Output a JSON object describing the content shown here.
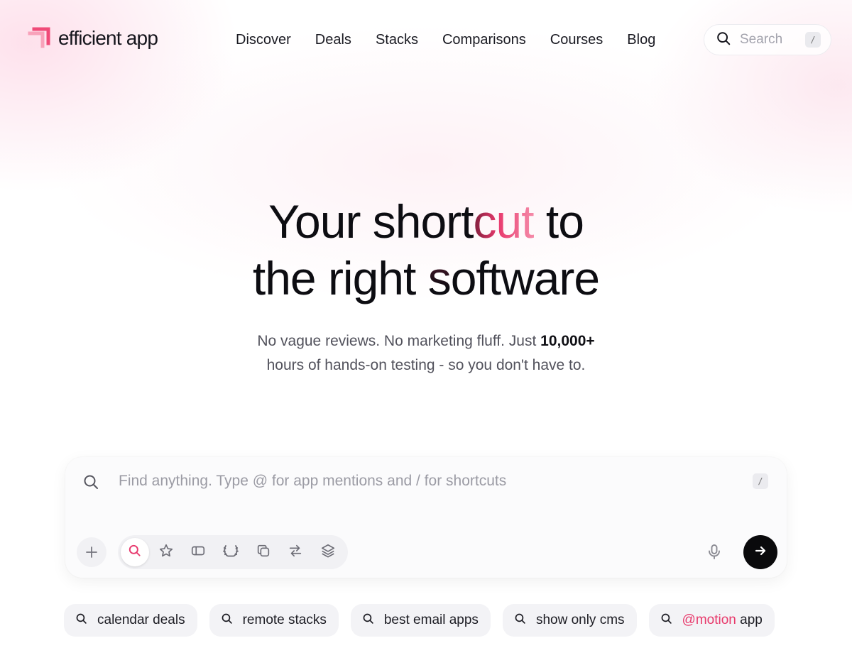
{
  "brand": {
    "name": "efficient app",
    "accent": "#e8396d"
  },
  "nav": {
    "items": [
      {
        "label": "Discover"
      },
      {
        "label": "Deals"
      },
      {
        "label": "Stacks"
      },
      {
        "label": "Comparisons"
      },
      {
        "label": "Courses"
      },
      {
        "label": "Blog"
      }
    ],
    "search": {
      "placeholder": "Search",
      "shortcut": "/"
    }
  },
  "hero": {
    "title_part1": "Your short",
    "title_grad": "cut",
    "title_part2": " to",
    "title_line2_a": "the right ",
    "title_line2_grad": "s",
    "title_line2_b": "oftware",
    "sub_a": "No vague reviews. No marketing fluff. Just ",
    "sub_bold": "10,000+",
    "sub_b": "hours of hands-on testing - so you don't have to."
  },
  "composer": {
    "placeholder": "Find anything. Type @ for app mentions and / for shortcuts",
    "shortcut": "/",
    "tools": [
      {
        "icon": "search-icon",
        "active": true
      },
      {
        "icon": "star-icon"
      },
      {
        "icon": "ticket-icon"
      },
      {
        "icon": "laurel-icon"
      },
      {
        "icon": "stack-copy-icon"
      },
      {
        "icon": "compare-arrows-icon"
      },
      {
        "icon": "layers-icon"
      }
    ]
  },
  "suggestions": [
    {
      "label": "calendar deals"
    },
    {
      "label": "remote stacks"
    },
    {
      "label": "best email apps"
    },
    {
      "label": "show only cms"
    },
    {
      "mention": "@motion",
      "label": " app"
    }
  ]
}
